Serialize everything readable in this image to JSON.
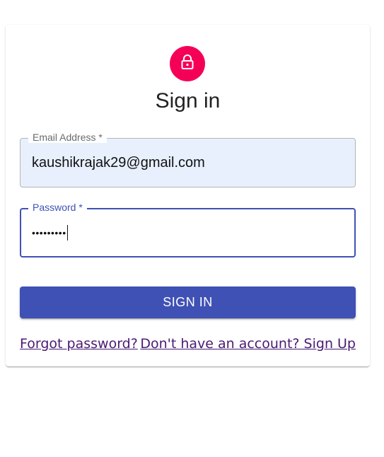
{
  "page": {
    "title": "Sign in"
  },
  "icons": {
    "avatar": "lock-icon"
  },
  "colors": {
    "avatar_bg": "#f50057",
    "primary": "#3f51b5",
    "autofill_bg": "#e8f0fe",
    "link": "#4a1a73"
  },
  "form": {
    "email": {
      "label": "Email Address *",
      "value": "kaushikrajak29@gmail.com"
    },
    "password": {
      "label": "Password *",
      "value": "•••••••••"
    },
    "submit_label": "SIGN IN"
  },
  "links": {
    "forgot_password": "Forgot password?",
    "sign_up": "Don't have an account? Sign Up"
  }
}
